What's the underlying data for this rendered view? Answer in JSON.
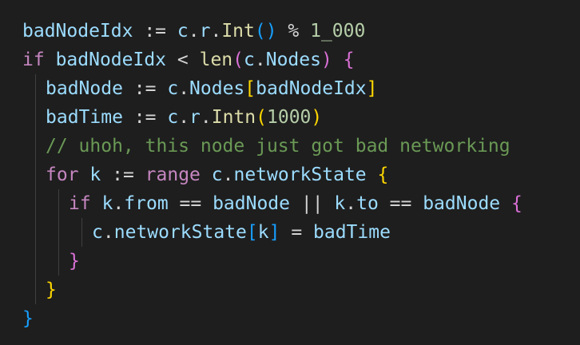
{
  "code": {
    "l1": {
      "a": "badNodeIdx",
      "b": " := ",
      "c": "c",
      "d": ".",
      "e": "r",
      "f": ".",
      "g": "Int",
      "h": "()",
      "i": " % ",
      "j": "1_000"
    },
    "l2": {
      "a": "if",
      "b": " ",
      "c": "badNodeIdx",
      "d": " < ",
      "e": "len",
      "f": "(",
      "g": "c",
      "h": ".",
      "i": "Nodes",
      "j": ")",
      "k": " ",
      "l": "{"
    },
    "l3": {
      "a": "badNode",
      "b": " := ",
      "c": "c",
      "d": ".",
      "e": "Nodes",
      "f": "[",
      "g": "badNodeIdx",
      "h": "]"
    },
    "l4": {
      "a": "badTime",
      "b": " := ",
      "c": "c",
      "d": ".",
      "e": "r",
      "f": ".",
      "g": "Intn",
      "h": "(",
      "i": "1000",
      "j": ")"
    },
    "l5": {
      "a": "// uhoh, this node just got bad networking"
    },
    "l6": {
      "a": "for",
      "b": " ",
      "c": "k",
      "d": " := ",
      "e": "range",
      "f": " ",
      "g": "c",
      "h": ".",
      "i": "networkState",
      "j": " ",
      "k": "{"
    },
    "l7": {
      "a": "if",
      "b": " ",
      "c": "k",
      "d": ".",
      "e": "from",
      "f": " == ",
      "g": "badNode",
      "h": " || ",
      "i": "k",
      "j": ".",
      "k": "to",
      "l": " == ",
      "m": "badNode",
      "n": " ",
      "o": "{"
    },
    "l8": {
      "a": "c",
      "b": ".",
      "c": "networkState",
      "d": "[",
      "e": "k",
      "f": "]",
      "g": " = ",
      "h": "badTime"
    },
    "l9": {
      "a": "}"
    },
    "l10": {
      "a": "}"
    },
    "l11": {
      "a": "}"
    }
  },
  "colors": {
    "background": "#1e1e1e",
    "variable": "#9cdcfe",
    "function": "#dcdcaa",
    "keyword": "#c586c0",
    "number": "#b5cea8",
    "comment": "#6a9955",
    "bracket_level1": "#ffd700",
    "bracket_level2": "#da70d6",
    "bracket_level3": "#179fff"
  }
}
